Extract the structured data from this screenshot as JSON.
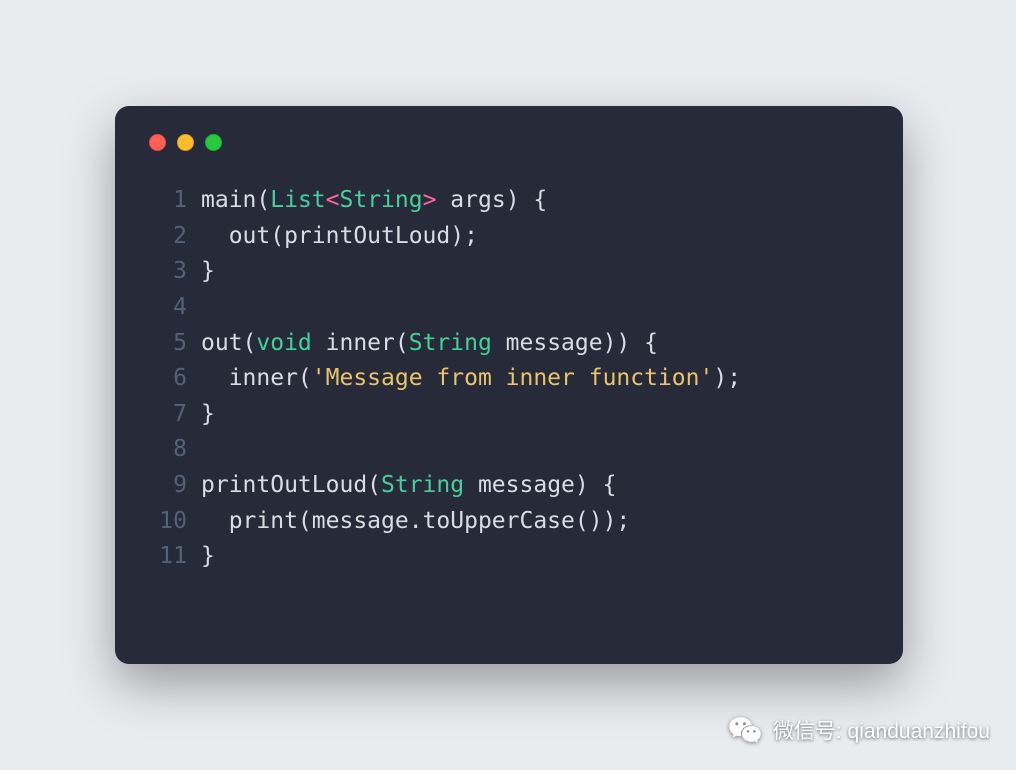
{
  "colors": {
    "background": "#e9ecef",
    "card": "#262a39",
    "gutter": "#546277",
    "text": "#d9dde3",
    "keyword": "#45d298",
    "angle": "#ff6a9d",
    "string": "#e9c46a",
    "traffic_red": "#ff5f56",
    "traffic_yellow": "#ffbd2e",
    "traffic_green": "#27c93f"
  },
  "code": {
    "lines": [
      {
        "n": "1",
        "tokens": [
          [
            "default",
            "main("
          ],
          [
            "keyword",
            "List"
          ],
          [
            "punct-a",
            "<"
          ],
          [
            "keyword",
            "String"
          ],
          [
            "punct-a",
            ">"
          ],
          [
            "default",
            " args) {"
          ]
        ]
      },
      {
        "n": "2",
        "tokens": [
          [
            "default",
            "  out(printOutLoud);"
          ]
        ]
      },
      {
        "n": "3",
        "tokens": [
          [
            "default",
            "}"
          ]
        ]
      },
      {
        "n": "4",
        "tokens": [
          [
            "default",
            ""
          ]
        ]
      },
      {
        "n": "5",
        "tokens": [
          [
            "default",
            "out("
          ],
          [
            "keyword",
            "void"
          ],
          [
            "default",
            " inner("
          ],
          [
            "keyword",
            "String"
          ],
          [
            "default",
            " message)) {"
          ]
        ]
      },
      {
        "n": "6",
        "tokens": [
          [
            "default",
            "  inner("
          ],
          [
            "string",
            "'Message from inner function'"
          ],
          [
            "default",
            ");"
          ]
        ]
      },
      {
        "n": "7",
        "tokens": [
          [
            "default",
            "}"
          ]
        ]
      },
      {
        "n": "8",
        "tokens": [
          [
            "default",
            ""
          ]
        ]
      },
      {
        "n": "9",
        "tokens": [
          [
            "default",
            "printOutLoud("
          ],
          [
            "keyword",
            "String"
          ],
          [
            "default",
            " message) {"
          ]
        ]
      },
      {
        "n": "10",
        "tokens": [
          [
            "default",
            "  print(message.toUpperCase());"
          ]
        ]
      },
      {
        "n": "11",
        "tokens": [
          [
            "default",
            "}"
          ]
        ]
      }
    ]
  },
  "watermark": {
    "label_prefix": "微信号: ",
    "id": "qianduanzhifou",
    "icon": "wechat-icon"
  }
}
